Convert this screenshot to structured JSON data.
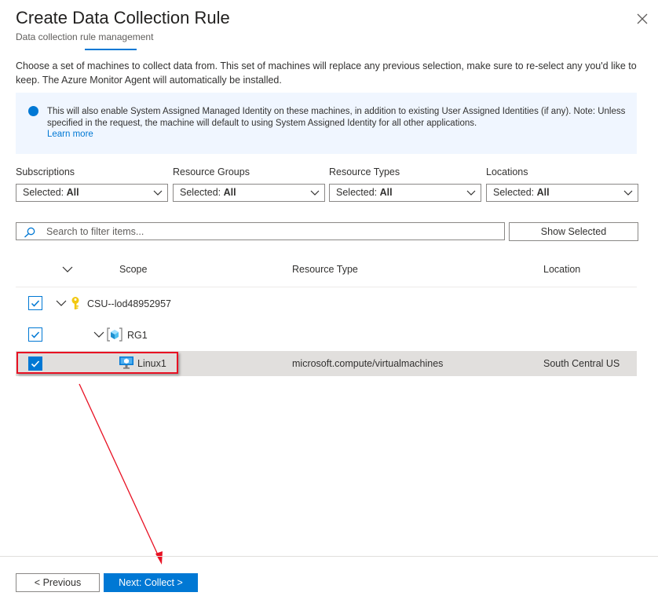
{
  "header": {
    "title": "Create Data Collection Rule",
    "subtitle": "Data collection rule management"
  },
  "intro_text": "Choose a set of machines to collect data from. This set of machines will replace any previous selection, make sure to re-select any you'd like to keep. The Azure Monitor Agent will automatically be installed.",
  "info_banner": {
    "text": "This will also enable System Assigned Managed Identity on these machines, in addition to existing User Assigned Identities (if any). Note: Unless specified in the request, the machine will default to using System Assigned Identity for all other applications.",
    "link": "Learn more"
  },
  "filters": [
    {
      "label": "Subscriptions",
      "prefix": "Selected:",
      "value": "All"
    },
    {
      "label": "Resource Groups",
      "prefix": "Selected:",
      "value": "All"
    },
    {
      "label": "Resource Types",
      "prefix": "Selected:",
      "value": "All"
    },
    {
      "label": "Locations",
      "prefix": "Selected:",
      "value": "All"
    }
  ],
  "search": {
    "placeholder": "Search to filter items..."
  },
  "show_selected_label": "Show Selected",
  "columns": {
    "scope": "Scope",
    "resource_type": "Resource Type",
    "location": "Location"
  },
  "tree": [
    {
      "name": "CSU--lod48952957",
      "icon": "key-icon",
      "checked": true,
      "resource_type": "",
      "location": ""
    },
    {
      "name": "RG1",
      "icon": "resource-group-icon",
      "checked": true,
      "resource_type": "",
      "location": ""
    },
    {
      "name": "Linux1",
      "icon": "virtual-machine-icon",
      "checked": true,
      "resource_type": "microsoft.compute/virtualmachines",
      "location": "South Central US"
    }
  ],
  "footer": {
    "previous_label": "< Previous",
    "next_label": "Next: Collect >"
  },
  "colors": {
    "accent": "#0078d4",
    "highlight": "#e81123",
    "selected_row": "#e1dfdd"
  }
}
